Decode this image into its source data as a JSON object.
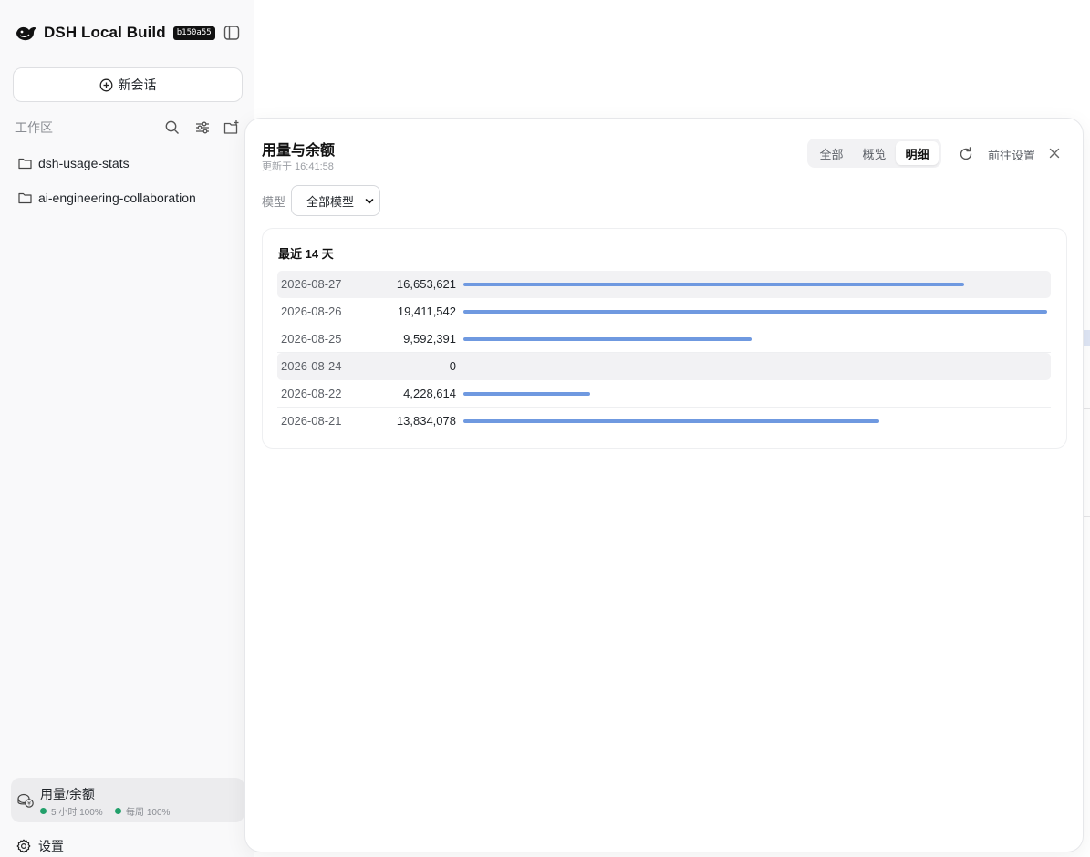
{
  "sidebar": {
    "app_title": "DSH Local Build",
    "build_badge": "b150a55",
    "new_chat_label": "新会话",
    "workspace_label": "工作区",
    "workspaces": [
      {
        "name": "dsh-usage-stats"
      },
      {
        "name": "ai-engineering-collaboration"
      }
    ],
    "usage_card": {
      "title": "用量/余额",
      "window_5h": "5 小时 100%",
      "separator": "·",
      "weekly": "每周 100%",
      "status_color": "#22a06b"
    },
    "settings_label": "设置"
  },
  "panel": {
    "title": "用量与余额",
    "updated": "更新于 16:41:58",
    "tabs": [
      {
        "label": "全部",
        "active": false
      },
      {
        "label": "概览",
        "active": false
      },
      {
        "label": "明细",
        "active": true
      }
    ],
    "goto_settings_label": "前往设置",
    "model_label": "模型",
    "model_select_value": "全部模型",
    "card_title": "最近 14 天",
    "bar_color": "#6f99e0",
    "max_value": 19411542,
    "rows": [
      {
        "date": "2026-08-27",
        "value_text": "16,653,621",
        "value": 16653621,
        "highlight": true
      },
      {
        "date": "2026-08-26",
        "value_text": "19,411,542",
        "value": 19411542,
        "highlight": false
      },
      {
        "date": "2026-08-25",
        "value_text": "9,592,391",
        "value": 9592391,
        "highlight": false
      },
      {
        "date": "2026-08-24",
        "value_text": "0",
        "value": 0,
        "highlight": true
      },
      {
        "date": "2026-08-22",
        "value_text": "4,228,614",
        "value": 4228614,
        "highlight": false
      },
      {
        "date": "2026-08-21",
        "value_text": "13,834,078",
        "value": 13834078,
        "highlight": false
      }
    ]
  }
}
